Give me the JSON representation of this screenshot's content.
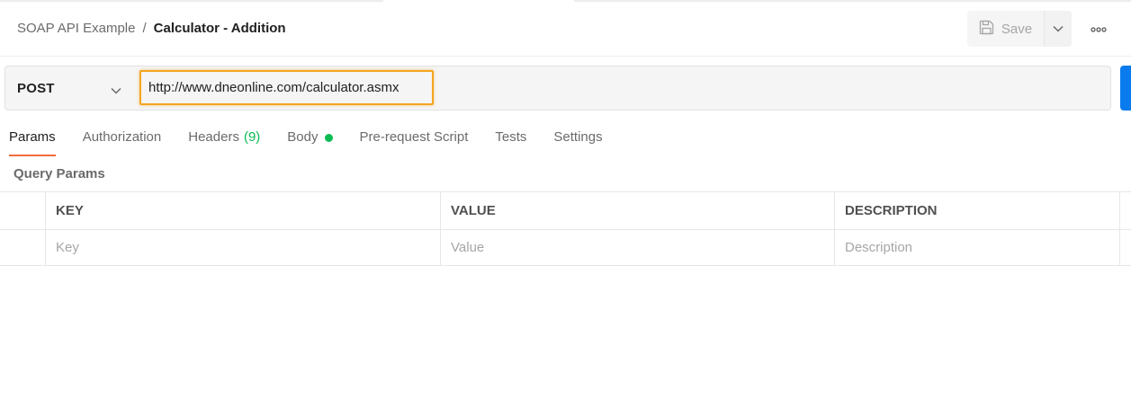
{
  "header": {
    "breadcrumb_parent": "SOAP API Example",
    "breadcrumb_separator": "/",
    "breadcrumb_current": "Calculator - Addition",
    "save_label": "Save",
    "save_icon": "floppy-disk-icon",
    "more_icon": "more-horizontal-icon"
  },
  "request": {
    "method": "POST",
    "url": "http://www.dneonline.com/calculator.asmx",
    "highlight_color": "#f4a521",
    "send_color": "#097bed"
  },
  "tabs": [
    {
      "label": "Params",
      "active": true
    },
    {
      "label": "Authorization"
    },
    {
      "label": "Headers",
      "count": "(9)"
    },
    {
      "label": "Body",
      "indicator_color": "#0cbb52"
    },
    {
      "label": "Pre-request Script"
    },
    {
      "label": "Tests"
    },
    {
      "label": "Settings"
    }
  ],
  "query_params": {
    "title": "Query Params",
    "columns": [
      "KEY",
      "VALUE",
      "DESCRIPTION"
    ],
    "placeholders": [
      "Key",
      "Value",
      "Description"
    ]
  },
  "colors": {
    "active_tab_underline": "#f26b3a",
    "accent_green": "#0cbb52"
  }
}
